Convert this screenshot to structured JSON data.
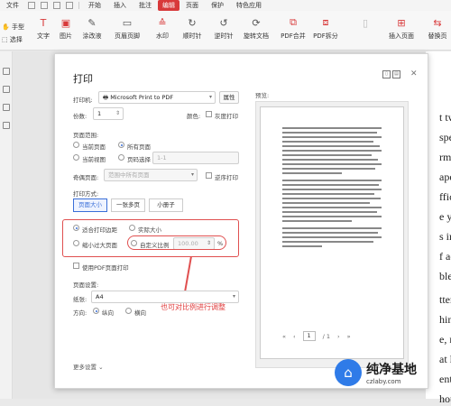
{
  "menubar": {
    "items": [
      "文件",
      "开始",
      "插入",
      "批注",
      "编辑",
      "页面",
      "保护",
      "特色应用"
    ],
    "active_index": 4
  },
  "toolbar": {
    "left": {
      "hand": "手型",
      "select": "选择"
    },
    "items": [
      "文字",
      "图片",
      "涂改液",
      "页眉页脚",
      "水印",
      "顺时针",
      "逆时针",
      "旋转文档",
      "PDF合并",
      "PDF拆分",
      "",
      "插入页面",
      "替换页"
    ]
  },
  "document_text": [
    "t tw",
    "spe",
    "rm c",
    "ape",
    "ffic",
    "e yo",
    "s in",
    "f ac",
    "ble",
    "tter",
    "hin",
    "e, r",
    "at le",
    "ent",
    "hou"
  ],
  "dialog": {
    "title": "打印",
    "printer_label": "打印机:",
    "printer_value": "Microsoft Print to PDF",
    "properties_btn": "属性",
    "copies_label": "份数:",
    "copies_value": "1",
    "color_label": "颜色:",
    "grayscale_label": "灰度打印",
    "page_range_label": "页面范围:",
    "range_options": [
      "当前页面",
      "所有页面",
      "当前视图",
      "页码选择"
    ],
    "page_input_placeholder": "1-1",
    "subset_label": "奇偶页面:",
    "subset_value": "范围中所有页面",
    "reverse_label": "逆序打印",
    "print_mode_label": "打印方式:",
    "print_modes": [
      "页面大小",
      "一张多页",
      "小册子"
    ],
    "fit_options": [
      "适合打印边距",
      "实际大小",
      "缩小过大页面",
      "自定义比例"
    ],
    "scale_value": "100.00",
    "scale_unit": "%",
    "paper_source_label": "使用PDF页面打印",
    "page_setup_label": "页面设置:",
    "paper_label": "纸张:",
    "paper_value": "A4",
    "direction_label": "方向:",
    "directions": [
      "纵向",
      "横向"
    ],
    "preview_label": "预览:",
    "page_current": "1",
    "page_total": "/ 1",
    "more_settings": "更多设置 ⌄",
    "annotation": "也可对比例进行调整"
  },
  "watermark": {
    "title": "纯净基地",
    "url": "czlaby.com"
  }
}
